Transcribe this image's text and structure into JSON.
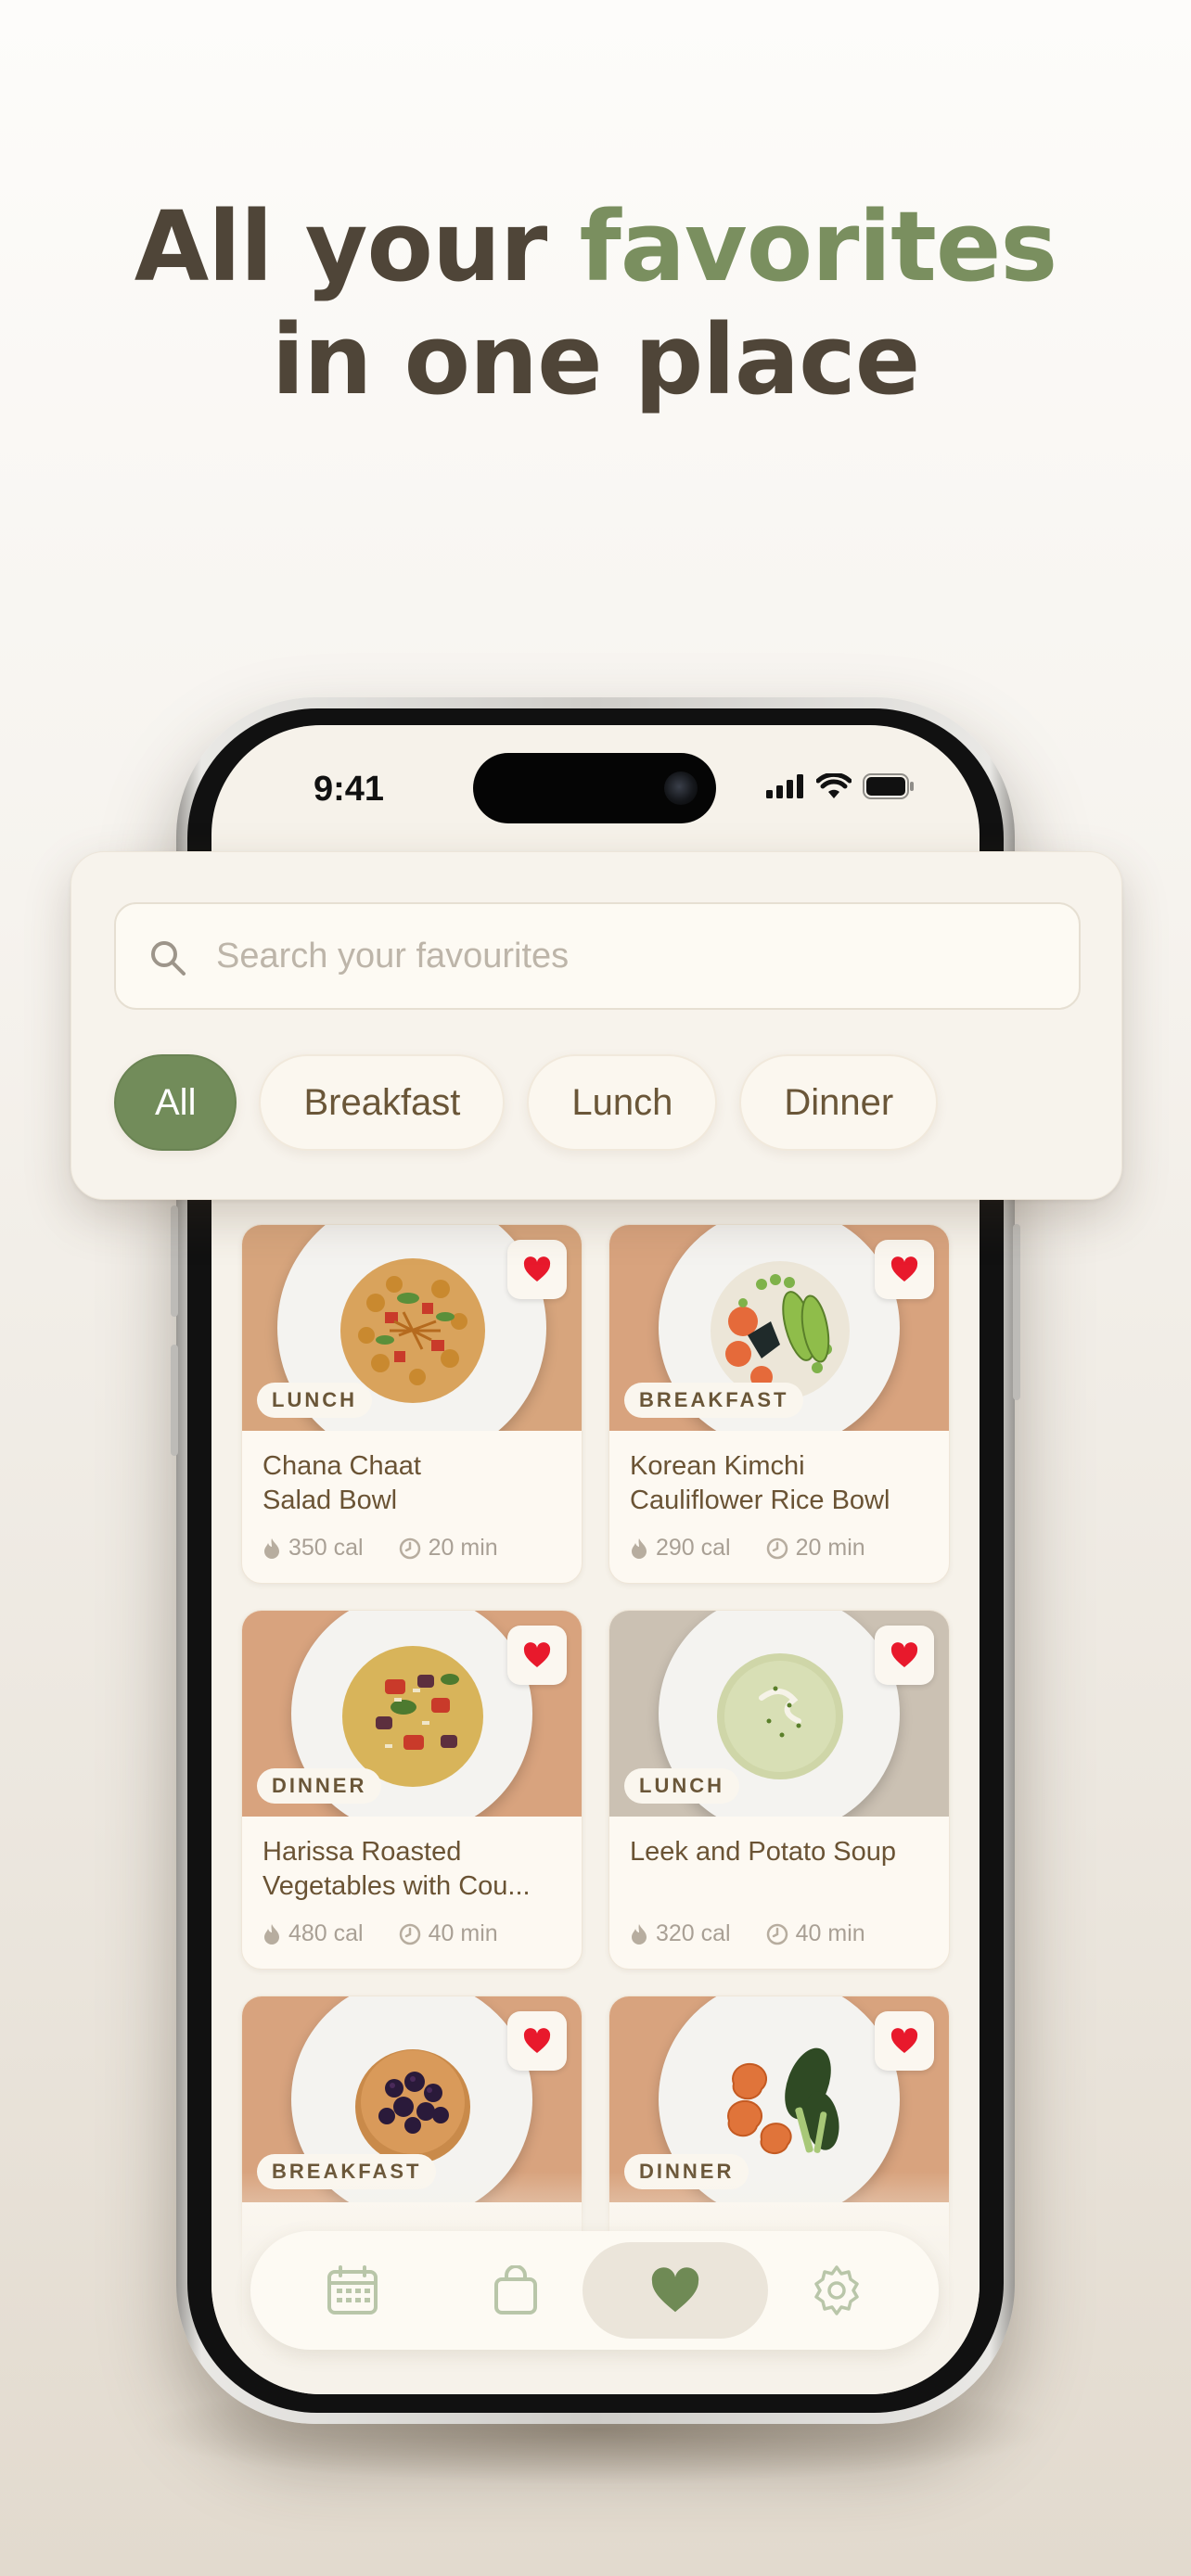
{
  "headline": {
    "line1_prefix": "All your ",
    "line1_accent": "favorites",
    "line2": "in one place"
  },
  "colors": {
    "accent": "#7a8f5f",
    "chip_active": "#728c5a",
    "heart": "#e8192c",
    "text_brown": "#6a5334",
    "headline_dark": "#4f4538"
  },
  "status_bar": {
    "time": "9:41",
    "icons": [
      "signal-icon",
      "wifi-icon",
      "battery-icon"
    ]
  },
  "search": {
    "placeholder": "Search your favourites",
    "value": ""
  },
  "filters": [
    {
      "label": "All",
      "selected": true
    },
    {
      "label": "Breakfast",
      "selected": false
    },
    {
      "label": "Lunch",
      "selected": false
    },
    {
      "label": "Dinner",
      "selected": false
    }
  ],
  "recipes": [
    {
      "tag": "LUNCH",
      "title": "Chana Chaat Salad Bowl",
      "calories": "350 cal",
      "time": "20 min",
      "favorite": true
    },
    {
      "tag": "BREAKFAST",
      "title": "Korean Kimchi Cauliflower Rice Bowl",
      "calories": "290 cal",
      "time": "20 min",
      "favorite": true
    },
    {
      "tag": "DINNER",
      "title": "Harissa Roasted Vegetables with Cou...",
      "calories": "480 cal",
      "time": "40 min",
      "favorite": true
    },
    {
      "tag": "LUNCH",
      "title": "Leek and Potato Soup",
      "calories": "320 cal",
      "time": "40 min",
      "favorite": true
    },
    {
      "tag": "BREAKFAST",
      "title": "",
      "calories": "",
      "time": "",
      "favorite": true
    },
    {
      "tag": "DINNER",
      "title": "",
      "calories": "",
      "time": "",
      "favorite": true
    }
  ],
  "tabbar": {
    "tabs": [
      "calendar-icon",
      "shopping-bag-icon",
      "heart-icon",
      "gear-icon"
    ],
    "active": "heart-icon"
  }
}
